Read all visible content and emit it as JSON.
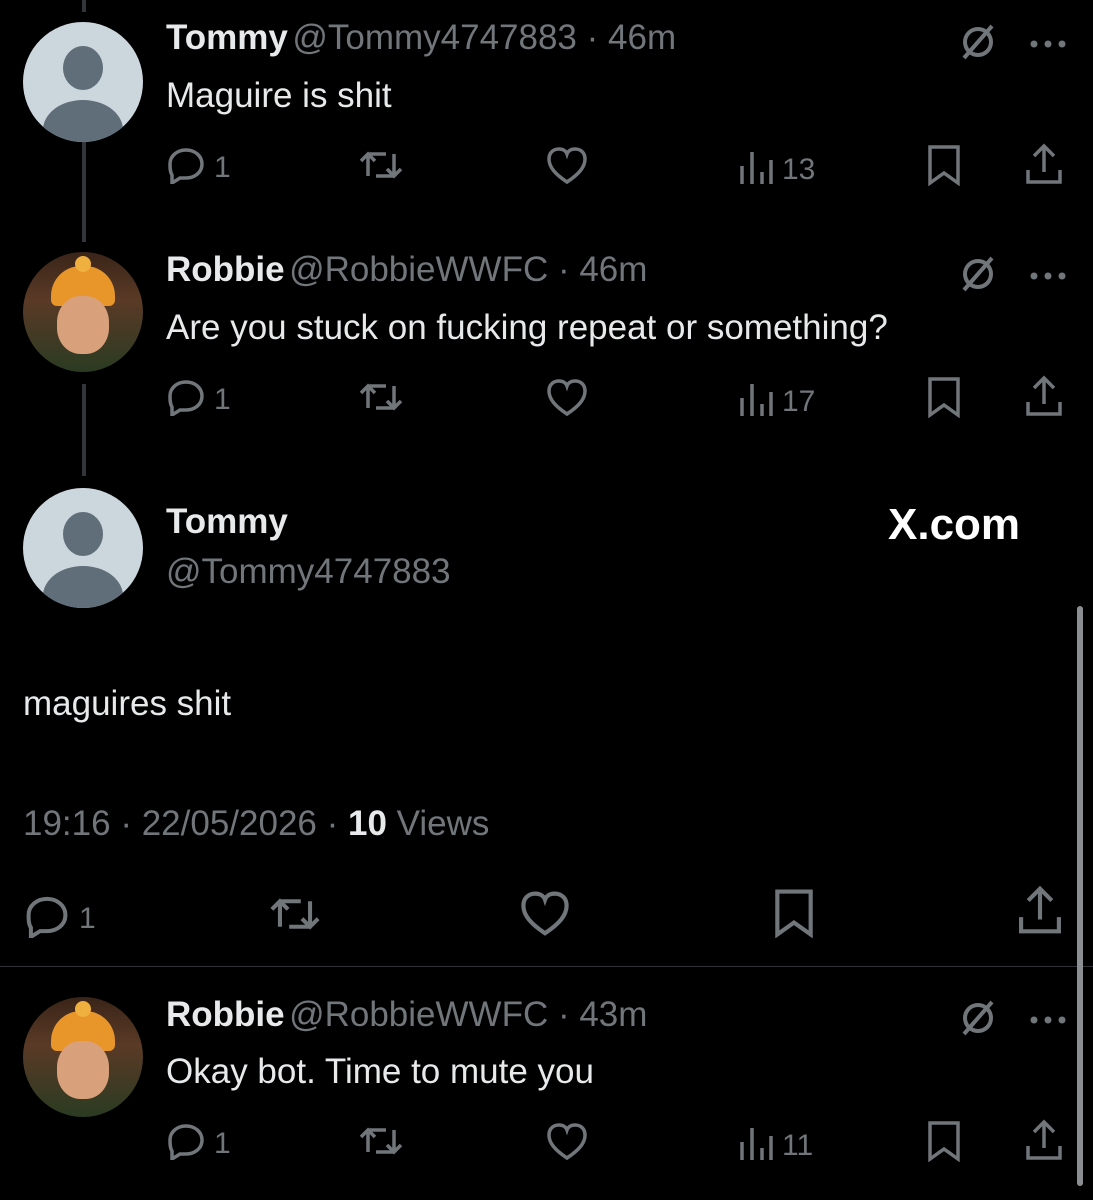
{
  "tweets": [
    {
      "name": "Tommy",
      "handle": "@Tommy4747883",
      "dot": " · ",
      "time": "46m",
      "text": "Maguire is shit",
      "replies": "1",
      "views": "13"
    },
    {
      "name": "Robbie",
      "handle": "@RobbieWWFC",
      "dot": " · ",
      "time": "46m",
      "text": "Are you stuck on fucking repeat or something?",
      "replies": "1",
      "views": "17"
    },
    {
      "name": "Robbie",
      "handle": "@RobbieWWFC",
      "dot": " · ",
      "time": "43m",
      "text": "Okay bot. Time to mute you",
      "replies": "1",
      "views": "11"
    }
  ],
  "focus": {
    "name": "Tommy",
    "handle": "@Tommy4747883",
    "brand": "X.com",
    "text": "maguires shit",
    "time": "19:16",
    "date": "22/05/2026",
    "sep": " · ",
    "views_count": "10",
    "views_label": " Views",
    "replies": "1"
  },
  "colors": {
    "background": "#000000",
    "text": "#e7e9ea",
    "secondary": "#71767b"
  }
}
